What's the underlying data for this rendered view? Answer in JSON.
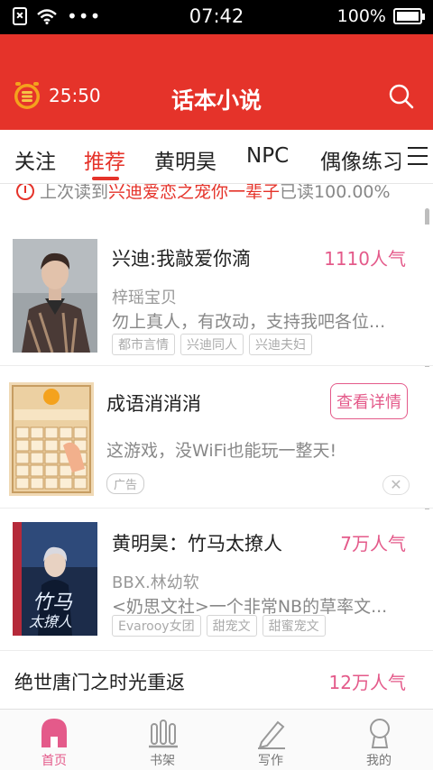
{
  "status_bar": {
    "time": "07:42",
    "battery": "100%",
    "icons": [
      "sim-off-icon",
      "wifi-icon",
      "more-dots-icon",
      "battery-icon"
    ]
  },
  "header": {
    "timer": "25:50",
    "title": "话本小说",
    "timer_icon": "coin-clock-icon",
    "search_icon": "search-icon"
  },
  "tabs": [
    "关注",
    "推荐",
    "黄明昊",
    "NPC",
    "偶像练习"
  ],
  "active_tab": "推荐",
  "last_read": {
    "prefix": "上次读到",
    "book": "兴迪爱恋之宠你一辈子",
    "suffix": "已读100.00%"
  },
  "feed": [
    {
      "title": "兴迪:我敲爱你滴",
      "popularity": "1110人气",
      "author": "梓瑶宝贝",
      "desc": "勿上真人，有改动，支持我吧各位...",
      "tags": [
        "都市言情",
        "兴迪同人",
        "兴迪夫妇"
      ]
    },
    {
      "title": "成语消消消",
      "button": "查看详情",
      "desc": "这游戏，没WiFi也能玩一整天!",
      "ad_label": "广告",
      "close": "✕"
    },
    {
      "title": "黄明昊：竹马太撩人",
      "popularity": "7万人气",
      "author": "BBX.林幼软",
      "desc": "<奶思文社>一个非常NB的草率文...",
      "tags": [
        "Evarooy女团",
        "甜宠文",
        "甜蜜宠文"
      ]
    },
    {
      "title": "绝世唐门之时光重返",
      "popularity": "12万人气"
    }
  ],
  "bottom_nav": [
    {
      "label": "首页",
      "icon": "home-icon",
      "active": true
    },
    {
      "label": "书架",
      "icon": "bookshelf-icon",
      "active": false
    },
    {
      "label": "写作",
      "icon": "pen-icon",
      "active": false
    },
    {
      "label": "我的",
      "icon": "profile-icon",
      "active": false
    }
  ],
  "colors": {
    "brand_red": "#e5332a",
    "accent_pink": "#e45a8a",
    "text_gray": "#888888"
  }
}
